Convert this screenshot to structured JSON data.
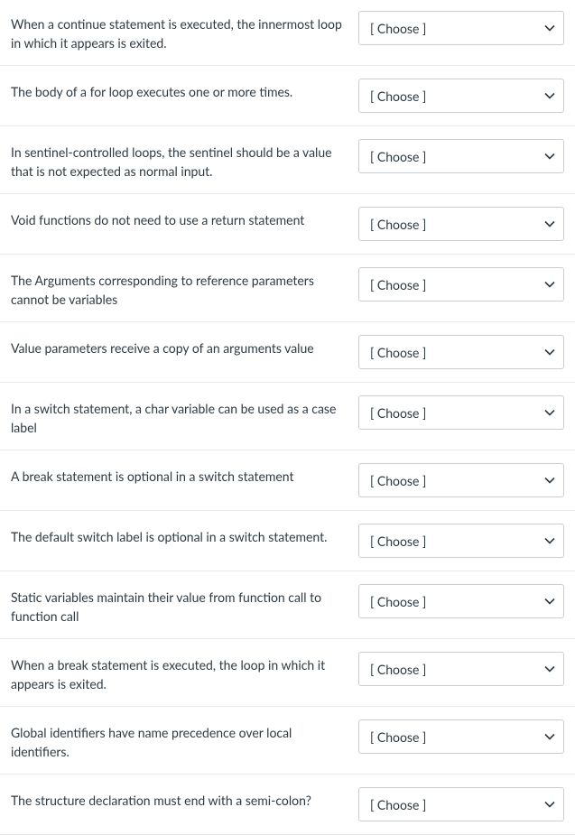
{
  "default_option": "[ Choose ]",
  "questions": [
    {
      "prompt": "When a continue statement is executed, the innermost loop in which it appears is exited."
    },
    {
      "prompt": "The body of a for loop executes one or more times."
    },
    {
      "prompt": "In sentinel-controlled loops, the sentinel should be a value that is not expected as normal input."
    },
    {
      "prompt": "Void functions do not need to use a return statement"
    },
    {
      "prompt": "The Arguments corresponding to reference parameters cannot be variables"
    },
    {
      "prompt": "Value parameters receive a copy of an arguments value"
    },
    {
      "prompt": "In a switch statement, a char variable can be used as a case label"
    },
    {
      "prompt": "A break statement is optional in a switch statement"
    },
    {
      "prompt": "The default switch label is optional in a switch statement."
    },
    {
      "prompt": "Static variables maintain their value from function call to function call"
    },
    {
      "prompt": "When a break statement is executed, the loop in which it appears is exited."
    },
    {
      "prompt": "Global identifiers have name precedence over local identifiers."
    },
    {
      "prompt": "The structure declaration must end with a semi-colon?"
    }
  ]
}
